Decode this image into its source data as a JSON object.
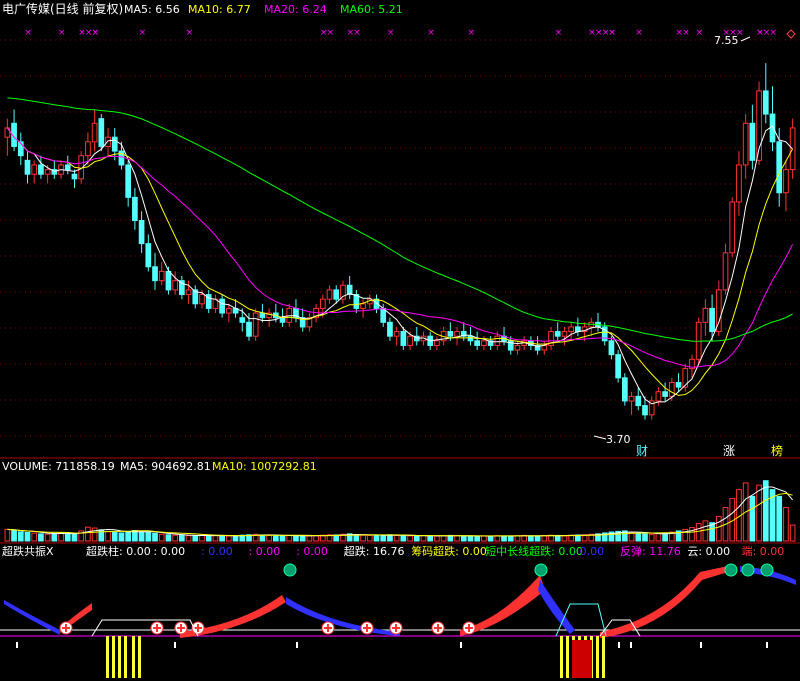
{
  "colors": {
    "background": "#000000",
    "up": "#ff3232",
    "down": "#54ffff",
    "ma5": "#ffffff",
    "ma10": "#ffff00",
    "ma20": "#ff00ff",
    "ma60": "#00ff00",
    "grid": "#8b0000",
    "separator": "#aa0000",
    "mark": "#ff00ff"
  },
  "price_panel": {
    "title": "电广传媒(日线 前复权)",
    "legend": [
      {
        "key": "ma5",
        "text": "MA5: 6.56",
        "color": "#ffffff"
      },
      {
        "key": "ma10",
        "text": "MA10: 6.77",
        "color": "#ffff00"
      },
      {
        "key": "ma20",
        "text": "MA20: 6.24",
        "color": "#ff00ff"
      },
      {
        "key": "ma60",
        "text": "MA60: 5.21",
        "color": "#00ff00"
      }
    ],
    "high_label": "7.55",
    "low_label": "3.70",
    "badges": [
      {
        "text": "财",
        "color": "#54ffff"
      },
      {
        "text": "涨",
        "color": "#ffffff"
      },
      {
        "text": "榜",
        "color": "#ffff00"
      }
    ]
  },
  "volume_panel": {
    "label": "VOLUME: 711858.19",
    "ma5": "MA5: 904692.81",
    "ma10": "MA10: 1007292.81"
  },
  "indicator_panel": {
    "title": "超跌共振X",
    "items": [
      {
        "text": "超跌柱: 0.00",
        "color": "#ffffff"
      },
      {
        "text": ": 0.00",
        "color": "#ffffff"
      },
      {
        "text": ": 0.00",
        "color": "#3030ff"
      },
      {
        "text": ": 0.00",
        "color": "#ff00ff"
      },
      {
        "text": ": 0.00",
        "color": "#ff00ff"
      },
      {
        "text": "超跌: 16.76",
        "color": "#ffffff"
      },
      {
        "text": "筹码超跌: 0.00",
        "color": "#ffff00"
      },
      {
        "text": "短中长线超跌: 0.00",
        "color": "#00ff00"
      },
      {
        "text": ": 0.00",
        "color": "#3030ff"
      },
      {
        "text": "反弹: 11.76",
        "color": "#ff00ff"
      },
      {
        "text": "云: 0.00",
        "color": "#ffffff"
      },
      {
        "text": "端: 0.00",
        "color": "#ff3232"
      }
    ]
  },
  "chart_data": {
    "type": "candlestick",
    "title": "电广传媒(日线 前复权)",
    "price_range": [
      3.5,
      7.8
    ],
    "ohlc": [
      [
        6.75,
        6.95,
        6.55,
        6.85
      ],
      [
        6.9,
        7.05,
        6.6,
        6.65
      ],
      [
        6.7,
        6.8,
        6.45,
        6.55
      ],
      [
        6.5,
        6.6,
        6.25,
        6.35
      ],
      [
        6.35,
        6.5,
        6.25,
        6.45
      ],
      [
        6.45,
        6.55,
        6.3,
        6.35
      ],
      [
        6.35,
        6.45,
        6.25,
        6.4
      ],
      [
        6.4,
        6.5,
        6.3,
        6.35
      ],
      [
        6.35,
        6.5,
        6.3,
        6.45
      ],
      [
        6.45,
        6.55,
        6.35,
        6.4
      ],
      [
        6.35,
        6.4,
        6.2,
        6.3
      ],
      [
        6.3,
        6.6,
        6.25,
        6.55
      ],
      [
        6.55,
        6.8,
        6.45,
        6.7
      ],
      [
        6.7,
        7.05,
        6.6,
        6.9
      ],
      [
        6.95,
        7.0,
        6.6,
        6.65
      ],
      [
        6.65,
        6.85,
        6.55,
        6.75
      ],
      [
        6.75,
        6.85,
        6.5,
        6.6
      ],
      [
        6.6,
        6.7,
        6.4,
        6.45
      ],
      [
        6.45,
        6.5,
        6.0,
        6.1
      ],
      [
        6.1,
        6.2,
        5.75,
        5.85
      ],
      [
        5.85,
        5.95,
        5.5,
        5.6
      ],
      [
        5.6,
        5.7,
        5.3,
        5.35
      ],
      [
        5.35,
        5.5,
        5.1,
        5.2
      ],
      [
        5.2,
        5.4,
        5.15,
        5.3
      ],
      [
        5.3,
        5.35,
        5.05,
        5.1
      ],
      [
        5.1,
        5.3,
        5.05,
        5.2
      ],
      [
        5.2,
        5.25,
        5.0,
        5.05
      ],
      [
        5.05,
        5.2,
        4.95,
        5.1
      ],
      [
        5.1,
        5.15,
        4.9,
        4.95
      ],
      [
        4.95,
        5.1,
        4.9,
        5.05
      ],
      [
        5.05,
        5.1,
        4.85,
        4.9
      ],
      [
        4.9,
        5.05,
        4.85,
        5.0
      ],
      [
        5.0,
        5.05,
        4.8,
        4.85
      ],
      [
        4.85,
        4.95,
        4.75,
        4.9
      ],
      [
        4.9,
        5.0,
        4.8,
        4.85
      ],
      [
        4.8,
        4.9,
        4.65,
        4.75
      ],
      [
        4.75,
        4.85,
        4.55,
        4.6
      ],
      [
        4.6,
        4.9,
        4.55,
        4.85
      ],
      [
        4.85,
        4.95,
        4.75,
        4.8
      ],
      [
        4.8,
        4.9,
        4.7,
        4.85
      ],
      [
        4.85,
        4.95,
        4.75,
        4.8
      ],
      [
        4.8,
        4.9,
        4.7,
        4.75
      ],
      [
        4.75,
        4.95,
        4.7,
        4.9
      ],
      [
        4.9,
        5.0,
        4.75,
        4.8
      ],
      [
        4.8,
        4.9,
        4.65,
        4.7
      ],
      [
        4.7,
        4.85,
        4.65,
        4.8
      ],
      [
        4.8,
        4.95,
        4.75,
        4.9
      ],
      [
        4.9,
        5.05,
        4.8,
        5.0
      ],
      [
        5.0,
        5.15,
        4.95,
        5.1
      ],
      [
        5.1,
        5.15,
        4.95,
        5.0
      ],
      [
        5.0,
        5.2,
        4.95,
        5.15
      ],
      [
        5.15,
        5.25,
        5.0,
        5.05
      ],
      [
        5.05,
        5.1,
        4.85,
        4.9
      ],
      [
        4.9,
        5.0,
        4.8,
        4.95
      ],
      [
        4.95,
        5.05,
        4.9,
        5.0
      ],
      [
        5.0,
        5.05,
        4.85,
        4.9
      ],
      [
        4.9,
        4.95,
        4.7,
        4.75
      ],
      [
        4.75,
        4.8,
        4.55,
        4.6
      ],
      [
        4.6,
        4.7,
        4.5,
        4.65
      ],
      [
        4.65,
        4.7,
        4.45,
        4.5
      ],
      [
        4.5,
        4.65,
        4.45,
        4.6
      ],
      [
        4.6,
        4.7,
        4.5,
        4.55
      ],
      [
        4.55,
        4.65,
        4.5,
        4.6
      ],
      [
        4.6,
        4.65,
        4.45,
        4.5
      ],
      [
        4.5,
        4.6,
        4.45,
        4.55
      ],
      [
        4.55,
        4.7,
        4.5,
        4.65
      ],
      [
        4.65,
        4.75,
        4.55,
        4.6
      ],
      [
        4.6,
        4.7,
        4.5,
        4.65
      ],
      [
        4.65,
        4.75,
        4.55,
        4.6
      ],
      [
        4.6,
        4.7,
        4.5,
        4.55
      ],
      [
        4.55,
        4.65,
        4.45,
        4.5
      ],
      [
        4.5,
        4.6,
        4.45,
        4.55
      ],
      [
        4.55,
        4.6,
        4.45,
        4.5
      ],
      [
        4.5,
        4.65,
        4.45,
        4.6
      ],
      [
        4.6,
        4.7,
        4.5,
        4.55
      ],
      [
        4.55,
        4.6,
        4.4,
        4.45
      ],
      [
        4.45,
        4.55,
        4.4,
        4.5
      ],
      [
        4.5,
        4.6,
        4.45,
        4.55
      ],
      [
        4.55,
        4.6,
        4.45,
        4.5
      ],
      [
        4.5,
        4.6,
        4.4,
        4.45
      ],
      [
        4.45,
        4.55,
        4.4,
        4.5
      ],
      [
        4.5,
        4.7,
        4.45,
        4.65
      ],
      [
        4.65,
        4.75,
        4.55,
        4.6
      ],
      [
        4.6,
        4.7,
        4.5,
        4.65
      ],
      [
        4.65,
        4.75,
        4.55,
        4.7
      ],
      [
        4.7,
        4.8,
        4.6,
        4.65
      ],
      [
        4.65,
        4.75,
        4.55,
        4.7
      ],
      [
        4.7,
        4.8,
        4.6,
        4.75
      ],
      [
        4.75,
        4.85,
        4.65,
        4.7
      ],
      [
        4.7,
        4.75,
        4.5,
        4.55
      ],
      [
        4.55,
        4.6,
        4.35,
        4.4
      ],
      [
        4.4,
        4.45,
        4.1,
        4.15
      ],
      [
        4.15,
        4.2,
        3.85,
        3.9
      ],
      [
        3.9,
        4.0,
        3.75,
        3.95
      ],
      [
        3.95,
        4.05,
        3.8,
        3.85
      ],
      [
        3.85,
        3.95,
        3.7,
        3.75
      ],
      [
        3.75,
        3.95,
        3.7,
        3.9
      ],
      [
        3.9,
        4.05,
        3.85,
        4.0
      ],
      [
        4.0,
        4.1,
        3.9,
        3.95
      ],
      [
        3.95,
        4.15,
        3.9,
        4.1
      ],
      [
        4.1,
        4.2,
        4.0,
        4.05
      ],
      [
        4.05,
        4.3,
        4.0,
        4.25
      ],
      [
        4.25,
        4.4,
        4.15,
        4.35
      ],
      [
        4.35,
        4.8,
        4.3,
        4.75
      ],
      [
        4.75,
        5.0,
        4.6,
        4.9
      ],
      [
        4.9,
        5.05,
        4.55,
        4.65
      ],
      [
        4.65,
        5.2,
        4.6,
        5.1
      ],
      [
        5.1,
        5.6,
        5.05,
        5.5
      ],
      [
        5.5,
        6.1,
        5.45,
        6.05
      ],
      [
        6.05,
        6.6,
        5.9,
        6.45
      ],
      [
        6.45,
        7.0,
        6.3,
        6.9
      ],
      [
        6.9,
        7.1,
        6.4,
        6.5
      ],
      [
        6.5,
        7.35,
        6.45,
        7.25
      ],
      [
        7.25,
        7.55,
        6.9,
        7.0
      ],
      [
        7.0,
        7.3,
        6.6,
        6.7
      ],
      [
        6.7,
        6.85,
        6.0,
        6.15
      ],
      [
        6.15,
        6.5,
        5.95,
        6.4
      ],
      [
        6.4,
        6.95,
        6.3,
        6.85
      ]
    ],
    "volume_range": [
      0,
      3000000
    ],
    "volume": [
      520000,
      480000,
      410000,
      380000,
      350000,
      320000,
      300000,
      340000,
      360000,
      330000,
      310000,
      450000,
      620000,
      580000,
      500000,
      420000,
      380000,
      360000,
      430000,
      470000,
      410000,
      380000,
      340000,
      300000,
      280000,
      260000,
      250000,
      240000,
      230000,
      260000,
      250000,
      240000,
      230000,
      220000,
      240000,
      260000,
      280000,
      300000,
      270000,
      250000,
      240000,
      230000,
      250000,
      240000,
      230000,
      220000,
      240000,
      260000,
      280000,
      270000,
      300000,
      320000,
      290000,
      260000,
      250000,
      240000,
      260000,
      280000,
      250000,
      240000,
      230000,
      220000,
      240000,
      230000,
      220000,
      230000,
      250000,
      240000,
      230000,
      220000,
      210000,
      230000,
      220000,
      240000,
      230000,
      220000,
      240000,
      250000,
      230000,
      220000,
      240000,
      260000,
      250000,
      240000,
      260000,
      270000,
      280000,
      300000,
      320000,
      360000,
      400000,
      430000,
      450000,
      380000,
      340000,
      310000,
      300000,
      330000,
      350000,
      400000,
      450000,
      520000,
      600000,
      780000,
      900000,
      820000,
      1100000,
      1500000,
      1900000,
      2300000,
      2600000,
      2000000,
      2500000,
      2700000,
      2300000,
      2000000,
      1500000,
      711858.19
    ],
    "series": [
      {
        "name": "MA5",
        "values_note": "computed from close"
      },
      {
        "name": "MA10"
      },
      {
        "name": "MA20"
      },
      {
        "name": "MA60"
      }
    ],
    "xlabel": "",
    "ylabel": "",
    "grid": true
  }
}
